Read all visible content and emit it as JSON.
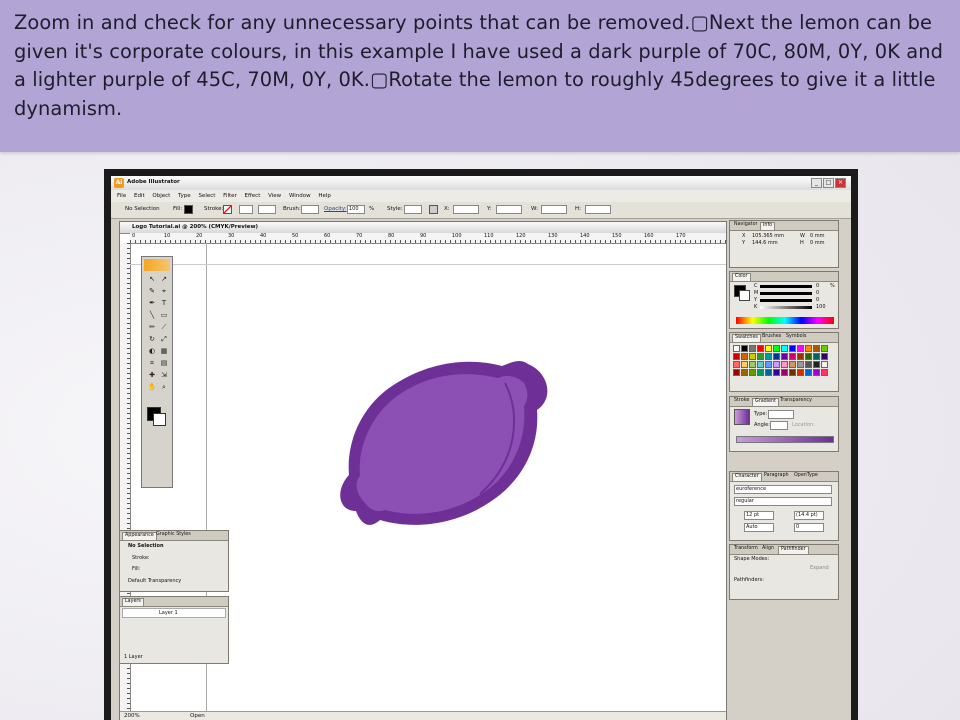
{
  "slide": {
    "caption": "Zoom in and check for any unnecessary points that can be removed.▢Next the lemon can be given it's corporate colours, in this example I have used a dark purple of 70C, 80M, 0Y, 0K and a lighter purple of 45C, 70M, 0Y, 0K.▢Rotate the lemon to roughly 45degrees to give it a little dynamism.",
    "band_color": "#b2a4d5"
  },
  "app": {
    "title": "Adobe Illustrator",
    "menu": [
      "File",
      "Edit",
      "Object",
      "Type",
      "Select",
      "Filter",
      "Effect",
      "View",
      "Window",
      "Help"
    ],
    "options": {
      "selection": "No Selection",
      "fill_label": "Fill:",
      "stroke_label": "Stroke:",
      "brush_label": "Brush:",
      "opacity_label": "Opacity:",
      "opacity_value": "100",
      "opacity_unit": "%",
      "style_label": "Style:",
      "x_label": "X:",
      "y_label": "Y:",
      "w_label": "W:",
      "h_label": "H:"
    }
  },
  "document": {
    "title": "Logo Tutorial.ai @ 200% (CMYK/Preview)",
    "ruler_ticks": [
      "0",
      "10",
      "20",
      "30",
      "40",
      "50",
      "60",
      "70",
      "80",
      "90",
      "100",
      "110",
      "120",
      "130",
      "140",
      "150",
      "160",
      "170"
    ],
    "status_zoom": "200%",
    "status_label": "Open"
  },
  "artwork": {
    "dark_purple": "#6e2f96",
    "light_purple": "#8c50b4"
  },
  "panels": {
    "navigator": {
      "tabs": [
        "Navigator",
        "Info"
      ],
      "x_label": "X",
      "y_label": "Y",
      "x_value": "105.365 mm",
      "y_value": "144.6 mm",
      "w_label": "W",
      "h_label": "H",
      "w_value": "0 mm",
      "h_value": "0 mm"
    },
    "color": {
      "tab": "Color",
      "channels": [
        "C",
        "M",
        "Y",
        "K"
      ],
      "values": [
        "0",
        "0",
        "0",
        "100"
      ],
      "unit": "%"
    },
    "swatches": {
      "tabs": [
        "Swatches",
        "Brushes",
        "Symbols"
      ]
    },
    "gradient": {
      "tabs": [
        "Stroke",
        "Gradient",
        "Transparency"
      ],
      "type_label": "Type:",
      "angle_label": "Angle:",
      "location_label": "Location:"
    },
    "character": {
      "tabs": [
        "Character",
        "Paragraph",
        "OpenType"
      ],
      "font": "euroference",
      "style": "regular",
      "size": "12 pt",
      "leading": "(14.4 pt)",
      "kerning": "Auto",
      "tracking": "0"
    },
    "pathfinder": {
      "tabs": [
        "Transform",
        "Align",
        "Pathfinder"
      ],
      "shape_modes": "Shape Modes:",
      "expand": "Expand",
      "pathfinders": "Pathfinders:"
    },
    "appearance": {
      "tabs": [
        "Appearance",
        "Graphic Styles"
      ],
      "selection": "No Selection",
      "stroke": "Stroke:",
      "fill": "Fill:",
      "transparency": "Default Transparency"
    },
    "layers": {
      "tab": "Layers",
      "layer_name": "Layer 1",
      "footer": "1 Layer"
    }
  },
  "swatch_colors": [
    "#ffffff",
    "#000000",
    "#777777",
    "#ff0000",
    "#ffff00",
    "#00ff00",
    "#00ffff",
    "#0000ff",
    "#ff00ff",
    "#ff8800",
    "#aa5500",
    "#66cc00",
    "#cc0000",
    "#cc6600",
    "#cccc00",
    "#339933",
    "#009999",
    "#003399",
    "#660099",
    "#cc0066",
    "#993300",
    "#336600",
    "#006666",
    "#330066",
    "#ff6666",
    "#ffcc66",
    "#99cc66",
    "#66cccc",
    "#6699ff",
    "#cc99ff",
    "#ff99cc",
    "#cc9966",
    "#999999",
    "#555555",
    "#222222",
    "#f0f0f0",
    "#990000",
    "#996600",
    "#669900",
    "#009966",
    "#006699",
    "#330099",
    "#990066",
    "#663300",
    "#cc3300",
    "#0066cc",
    "#9900cc",
    "#ff3366"
  ]
}
